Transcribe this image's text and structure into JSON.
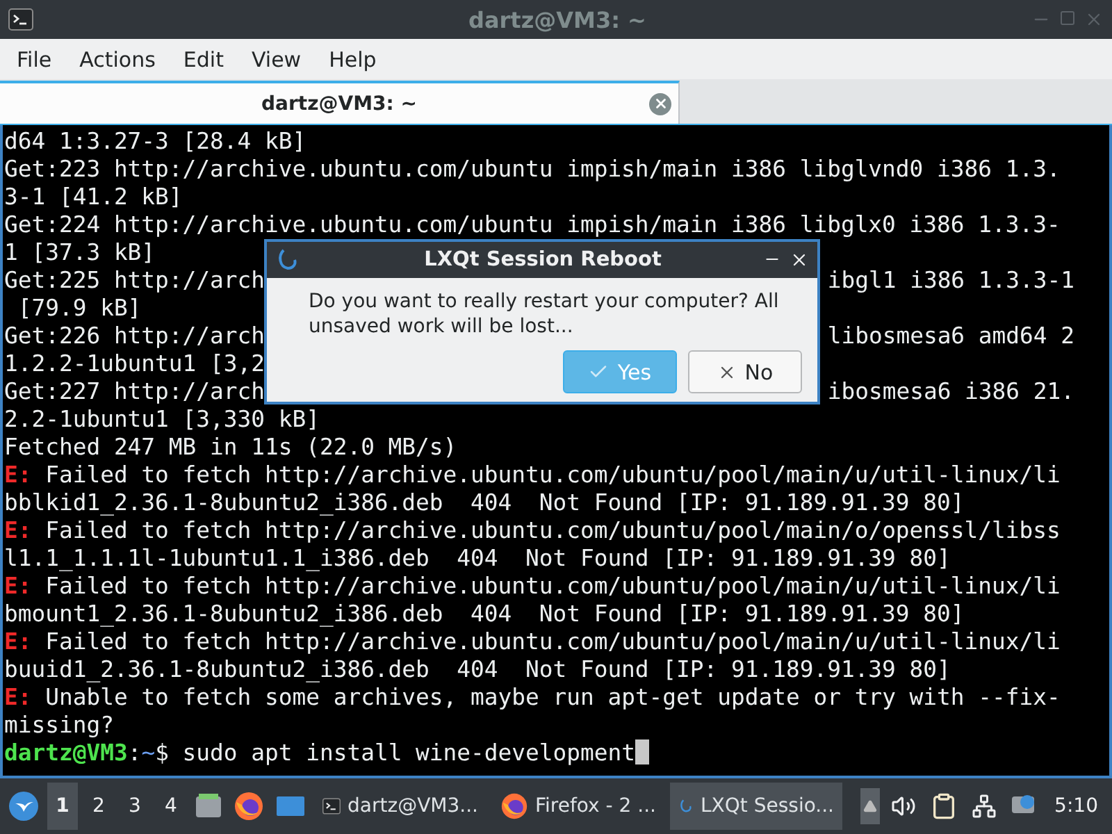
{
  "window": {
    "title": "dartz@VM3: ~"
  },
  "menu": [
    "File",
    "Actions",
    "Edit",
    "View",
    "Help"
  ],
  "tabs": [
    {
      "label": "dartz@VM3: ~",
      "selected": true
    }
  ],
  "terminal": {
    "lines": [
      {
        "kind": "plain",
        "text": "d64 1:3.27-3 [28.4 kB]"
      },
      {
        "kind": "plain",
        "text": "Get:223 http://archive.ubuntu.com/ubuntu impish/main i386 libglvnd0 i386 1.3."
      },
      {
        "kind": "plain",
        "text": "3-1 [41.2 kB]"
      },
      {
        "kind": "plain",
        "text": "Get:224 http://archive.ubuntu.com/ubuntu impish/main i386 libglx0 i386 1.3.3-"
      },
      {
        "kind": "plain",
        "text": "1 [37.3 kB]"
      },
      {
        "kind": "split",
        "parts": [
          "Get:225 http://arch",
          "ibgl1 i386 1.3.3-1"
        ]
      },
      {
        "kind": "plain",
        "text": " [79.9 kB]"
      },
      {
        "kind": "split",
        "parts": [
          "Get:226 http://arch",
          "libosmesa6 amd64 2"
        ]
      },
      {
        "kind": "plain",
        "text": "1.2.2-1ubuntu1 [3,2"
      },
      {
        "kind": "split",
        "parts": [
          "Get:227 http://arch",
          "ibosmesa6 i386 21."
        ]
      },
      {
        "kind": "plain",
        "text": "2.2-1ubuntu1 [3,330 kB]"
      },
      {
        "kind": "plain",
        "text": "Fetched 247 MB in 11s (22.0 MB/s)"
      },
      {
        "kind": "error",
        "prefix": "E:",
        "text": " Failed to fetch http://archive.ubuntu.com/ubuntu/pool/main/u/util-linux/li"
      },
      {
        "kind": "plain",
        "text": "bblkid1_2.36.1-8ubuntu2_i386.deb  404  Not Found [IP: 91.189.91.39 80]"
      },
      {
        "kind": "error",
        "prefix": "E:",
        "text": " Failed to fetch http://archive.ubuntu.com/ubuntu/pool/main/o/openssl/libss"
      },
      {
        "kind": "plain",
        "text": "l1.1_1.1.1l-1ubuntu1.1_i386.deb  404  Not Found [IP: 91.189.91.39 80]"
      },
      {
        "kind": "error",
        "prefix": "E:",
        "text": " Failed to fetch http://archive.ubuntu.com/ubuntu/pool/main/u/util-linux/li"
      },
      {
        "kind": "plain",
        "text": "bmount1_2.36.1-8ubuntu2_i386.deb  404  Not Found [IP: 91.189.91.39 80]"
      },
      {
        "kind": "error",
        "prefix": "E:",
        "text": " Failed to fetch http://archive.ubuntu.com/ubuntu/pool/main/u/util-linux/li"
      },
      {
        "kind": "plain",
        "text": "buuid1_2.36.1-8ubuntu2_i386.deb  404  Not Found [IP: 91.189.91.39 80]"
      },
      {
        "kind": "error",
        "prefix": "E:",
        "text": " Unable to fetch some archives, maybe run apt-get update or try with --fix-"
      },
      {
        "kind": "plain",
        "text": "missing?"
      },
      {
        "kind": "prompt",
        "user": "dartz@VM3",
        "sep": ":",
        "path": "~",
        "command": "$ sudo apt install wine-development"
      }
    ]
  },
  "dialog": {
    "title": "LXQt Session Reboot",
    "message": "Do you want to really restart your computer? All unsaved work will be lost...",
    "buttons": [
      {
        "label": "Yes",
        "kind": "yes",
        "selected": true
      },
      {
        "label": "No",
        "kind": "no",
        "selected": false
      }
    ]
  },
  "taskbar": {
    "desktops": [
      {
        "label": "1",
        "selected": true
      },
      {
        "label": "2",
        "selected": false
      },
      {
        "label": "3",
        "selected": false
      },
      {
        "label": "4",
        "selected": false
      }
    ],
    "tasks": [
      {
        "label": "dartz@VM3...",
        "kind": "terminal",
        "selected": false
      },
      {
        "label": "Firefox - 2 ...",
        "kind": "firefox",
        "selected": false
      },
      {
        "label": "LXQt Sessio...",
        "kind": "session",
        "selected": true
      }
    ],
    "clock": "5:10"
  }
}
